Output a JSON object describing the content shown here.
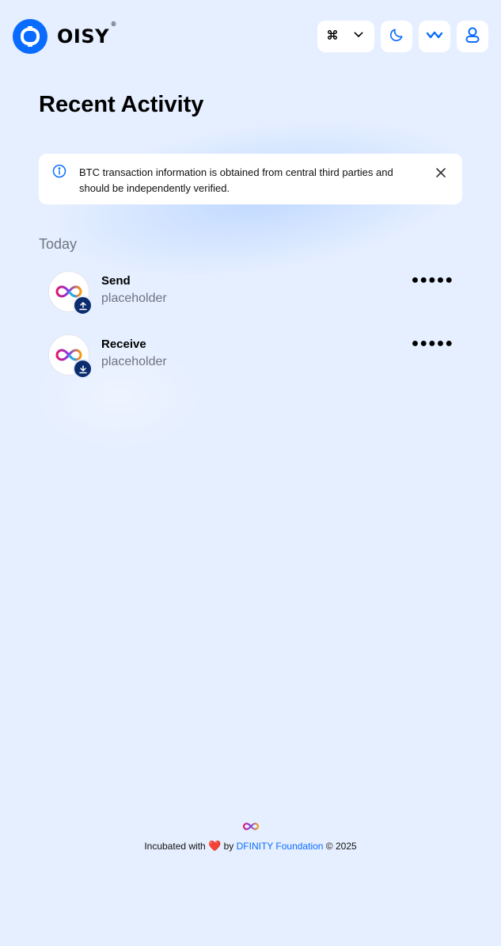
{
  "app": {
    "name": "OISY",
    "reg_mark": "®"
  },
  "header": {
    "network_button_icon": "command-icon",
    "theme_icon": "moon-icon",
    "wallet_icon": "wallet-connect-icon",
    "user_icon": "user-icon"
  },
  "page": {
    "title": "Recent Activity"
  },
  "banner": {
    "text": "BTC transaction information is obtained from central third parties and should be independently verified.",
    "info_icon": "info-icon",
    "close_icon": "close-icon"
  },
  "activity": {
    "section_label": "Today",
    "items": [
      {
        "name": "Send",
        "subtitle": "placeholder",
        "amount": "●●●●●",
        "direction": "send"
      },
      {
        "name": "Receive",
        "subtitle": "placeholder",
        "amount": "●●●●●",
        "direction": "receive"
      }
    ]
  },
  "footer": {
    "prefix": "Incubated with",
    "heart": "❤️",
    "by": "by",
    "link_text": "DFINITY Foundation",
    "suffix": "© 2025"
  },
  "colors": {
    "brand": "#0a6cff",
    "background": "#e6efff",
    "badge": "#0b2d6e"
  }
}
